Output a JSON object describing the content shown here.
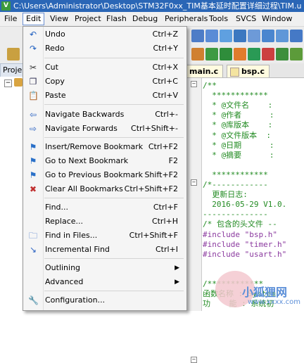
{
  "window": {
    "title": "C:\\Users\\Administrator\\Desktop\\STM32F0xx_TIM基本延时配置详细过程\\TIM.u",
    "app_icon": "keil-uvision-icon"
  },
  "menubar": [
    "File",
    "Edit",
    "View",
    "Project",
    "Flash",
    "Debug",
    "Peripherals",
    "Tools",
    "SVCS",
    "Window"
  ],
  "active_menu": "Edit",
  "project_tab": "Proje",
  "editor_tabs": [
    "main.c",
    "bsp.c"
  ],
  "edit_menu": [
    {
      "label": "Undo",
      "shortcut": "Ctrl+Z",
      "icon": "undo-icon"
    },
    {
      "label": "Redo",
      "shortcut": "Ctrl+Y",
      "icon": "redo-icon"
    },
    {
      "label": "Cut",
      "shortcut": "Ctrl+X",
      "icon": "cut-icon"
    },
    {
      "label": "Copy",
      "shortcut": "Ctrl+C",
      "icon": "copy-icon"
    },
    {
      "label": "Paste",
      "shortcut": "Ctrl+V",
      "icon": "paste-icon"
    },
    {
      "label": "Navigate Backwards",
      "shortcut": "Ctrl+-",
      "icon": "arrow-left-icon"
    },
    {
      "label": "Navigate Forwards",
      "shortcut": "Ctrl+Shift+-",
      "icon": "arrow-right-icon"
    },
    {
      "label": "Insert/Remove Bookmark",
      "shortcut": "Ctrl+F2",
      "icon": "bookmark-icon"
    },
    {
      "label": "Go to Next Bookmark",
      "shortcut": "F2",
      "icon": "next-bookmark-icon"
    },
    {
      "label": "Go to Previous Bookmark",
      "shortcut": "Shift+F2",
      "icon": "prev-bookmark-icon"
    },
    {
      "label": "Clear All Bookmarks",
      "shortcut": "Ctrl+Shift+F2",
      "icon": "clear-bookmarks-icon"
    },
    {
      "label": "Find...",
      "shortcut": "Ctrl+F",
      "icon": ""
    },
    {
      "label": "Replace...",
      "shortcut": "Ctrl+H",
      "icon": ""
    },
    {
      "label": "Find in Files...",
      "shortcut": "Ctrl+Shift+F",
      "icon": "find-in-files-icon"
    },
    {
      "label": "Incremental Find",
      "shortcut": "Ctrl+I",
      "icon": "incremental-find-icon"
    },
    {
      "label": "Outlining",
      "shortcut": "",
      "icon": "",
      "submenu": true
    },
    {
      "label": "Advanced",
      "shortcut": "",
      "icon": "",
      "submenu": true
    },
    {
      "label": "Configuration...",
      "shortcut": "",
      "icon": "wrench-icon"
    }
  ],
  "code_lines": [
    {
      "text": "/**",
      "cls": "c-cm"
    },
    {
      "text": "  ************",
      "cls": "c-cm"
    },
    {
      "text": "  * @文件名    :",
      "cls": "c-cm"
    },
    {
      "text": "  * @作者      :",
      "cls": "c-cm"
    },
    {
      "text": "  * @库版本    :",
      "cls": "c-cm"
    },
    {
      "text": "  * @文件版本  :",
      "cls": "c-cm"
    },
    {
      "text": "  * @日期      :",
      "cls": "c-cm"
    },
    {
      "text": "  * @摘要      :",
      "cls": "c-cm"
    },
    {
      "text": "",
      "cls": "c-cm"
    },
    {
      "text": "  ************",
      "cls": "c-cm"
    },
    {
      "text": "/*------------",
      "cls": "c-cm"
    },
    {
      "text": "  更新日志:",
      "cls": "c-cm"
    },
    {
      "text": "  2016-05-29 V1.0.",
      "cls": "c-cm"
    },
    {
      "text": "--------------",
      "cls": "c-cm"
    },
    {
      "text": "/* 包含的头文件 --",
      "cls": "c-cm"
    },
    {
      "text": "#include \"bsp.h\"",
      "cls": "c-pp"
    },
    {
      "text": "#include \"timer.h\"",
      "cls": "c-pp"
    },
    {
      "text": "#include \"usart.h\"",
      "cls": "c-pp"
    },
    {
      "text": "",
      "cls": ""
    },
    {
      "text": "",
      "cls": ""
    },
    {
      "text": "/************",
      "cls": "c-cm"
    },
    {
      "text": "函数名称 : System",
      "cls": "c-cm"
    },
    {
      "text": "功    能 : 系统初",
      "cls": "c-cm"
    }
  ],
  "watermark": {
    "text": "小狐狸网",
    "url": "www.xxxx.com"
  },
  "colors": {
    "titlebar": "#2a66b6",
    "menu_bg": "#f5f5f5",
    "comment": "#228b22",
    "preprocessor": "#8b3a9f"
  }
}
